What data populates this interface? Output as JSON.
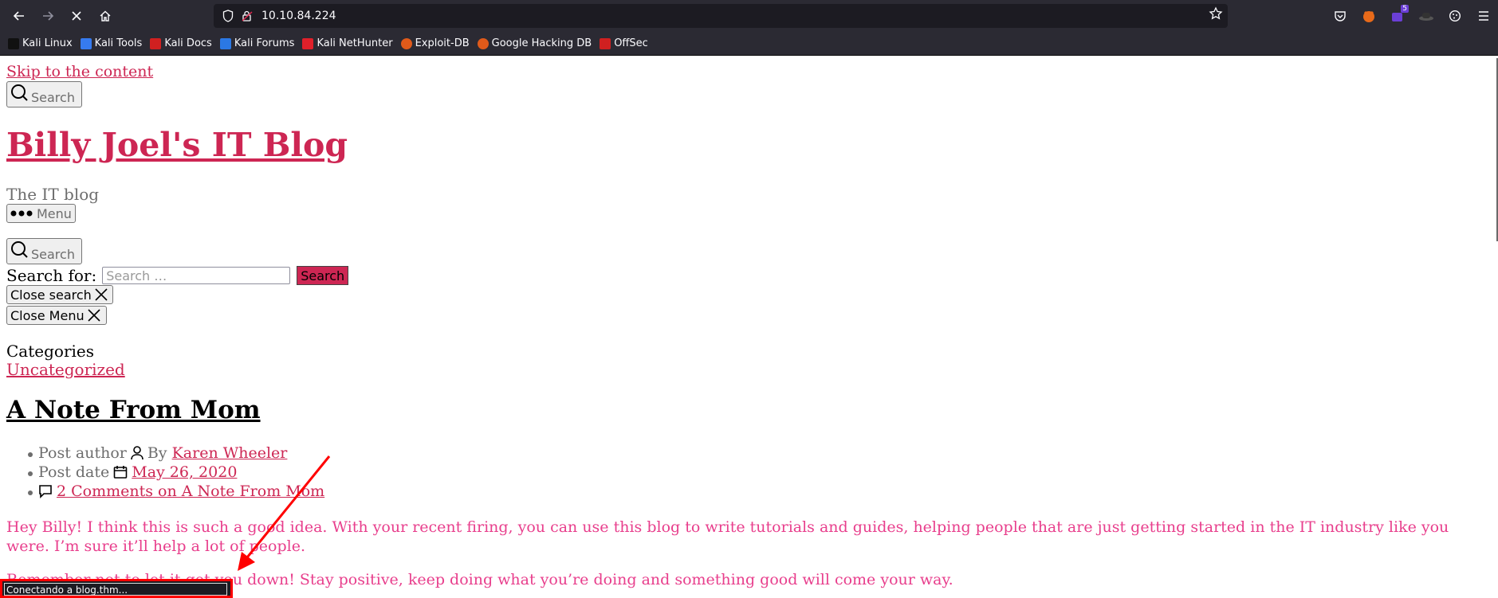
{
  "browser": {
    "url": "10.10.84.224",
    "extension_badge": "5",
    "bookmarks": [
      {
        "label": "Kali Linux",
        "color": "#2b2a33"
      },
      {
        "label": "Kali Tools",
        "color": "#367bf0"
      },
      {
        "label": "Kali Docs",
        "color": "#d02020"
      },
      {
        "label": "Kali Forums",
        "color": "#2b78e4"
      },
      {
        "label": "Kali NetHunter",
        "color": "#e0202a"
      },
      {
        "label": "Exploit-DB",
        "color": "#e05a1a"
      },
      {
        "label": "Google Hacking DB",
        "color": "#e05a1a"
      },
      {
        "label": "OffSec",
        "color": "#d02020"
      }
    ],
    "status_text": "Conectando a blog.thm..."
  },
  "page": {
    "skip_link": "Skip to the content",
    "search_toggle_label": "Search",
    "site_title": "Billy Joel's IT Blog",
    "tagline": "The IT blog",
    "menu_label": "Menu",
    "search_for_label": "Search for:",
    "search_placeholder": "Search …",
    "search_submit": "Search",
    "close_search": "Close search",
    "close_menu": "Close Menu",
    "categories_heading": "Categories",
    "category_link": "Uncategorized",
    "post": {
      "title": "A Note From Mom",
      "author_label": "Post author",
      "by": "By",
      "author": "Karen Wheeler",
      "date_label": "Post date",
      "date": "May 26, 2020",
      "comments": "2 Comments on A Note From Mom",
      "paragraph1": "Hey Billy!  I think this is such a good idea.  With your recent firing, you can use this blog to write tutorials and guides, helping people that are just getting started in the IT industry like you were.  I’m sure it’ll help a lot of people.",
      "paragraph2": "Remember not to let it get you down!  Stay positive, keep doing what you’re doing and something good will come your way."
    }
  },
  "colors": {
    "accent": "#cd2653",
    "body_text": "#e83e8c",
    "annotation": "#ff0000"
  }
}
